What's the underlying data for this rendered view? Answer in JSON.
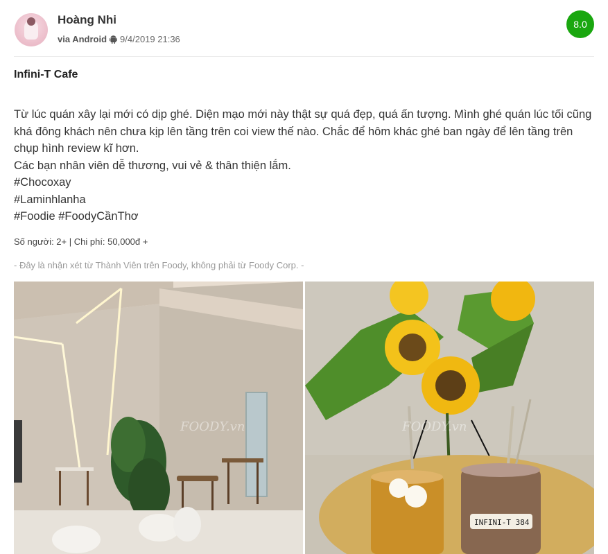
{
  "author": {
    "name": "Hoàng Nhi",
    "via": "via Android",
    "platform_icon": "android-icon",
    "datetime": "9/4/2019 21:36"
  },
  "score": "8.0",
  "review": {
    "title": "Infini-T Cafe",
    "lines": [
      "Từ lúc quán xây lại mới có dịp ghé. Diện mạo mới này thật sự quá đẹp, quá ấn tượng. Mình ghé quán lúc tối cũng khá đông khách nên chưa kịp lên tầng trên coi view thế nào. Chắc để hôm khác ghé ban ngày để lên tầng trên chụp hình review kĩ hơn.",
      "Các bạn nhân viên dễ thương, vui vẻ & thân thiện lắm.",
      "#Chocoxay",
      "#Laminhlanha",
      "#Foodie #FoodyCầnThơ"
    ],
    "info": "Số người: 2+ | Chi phí: 50,000đ +",
    "disclaimer": "- Đây là nhận xét từ Thành Viên trên Foody, không phải từ Foody Corp. -"
  },
  "photos": {
    "watermark": "FOODY.vn",
    "cup_label": "INFINI-T 384"
  },
  "colors": {
    "score_bg": "#1aa70f",
    "text": "#333333",
    "muted": "#999999"
  }
}
